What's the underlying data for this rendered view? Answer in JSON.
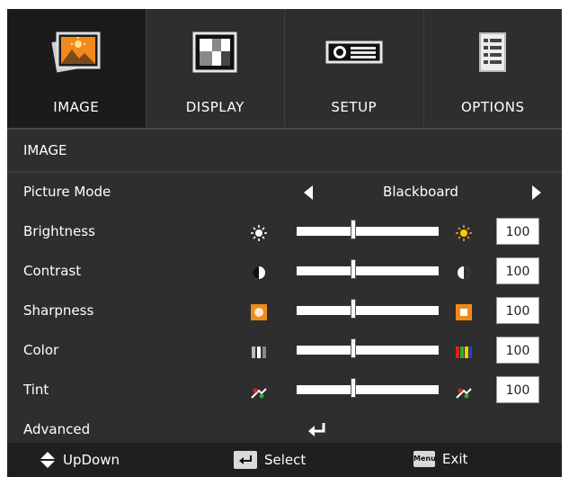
{
  "tabs": [
    {
      "label": "IMAGE",
      "icon": "image-icon",
      "active": true
    },
    {
      "label": "DISPLAY",
      "icon": "display-icon",
      "active": false
    },
    {
      "label": "SETUP",
      "icon": "setup-projector-icon",
      "active": false
    },
    {
      "label": "OPTIONS",
      "icon": "options-list-icon",
      "active": false
    }
  ],
  "section_title": "IMAGE",
  "picture_mode": {
    "label": "Picture Mode",
    "value": "Blackboard"
  },
  "settings": [
    {
      "label": "Brightness",
      "value": "100",
      "level": 0.4,
      "min_icon": "sun-dim-icon",
      "max_icon": "sun-bright-icon"
    },
    {
      "label": "Contrast",
      "value": "100",
      "level": 0.4,
      "min_icon": "contrast-low-icon",
      "max_icon": "contrast-high-icon"
    },
    {
      "label": "Sharpness",
      "value": "100",
      "level": 0.4,
      "min_icon": "sharpness-low-icon",
      "max_icon": "sharpness-high-icon"
    },
    {
      "label": "Color",
      "value": "100",
      "level": 0.4,
      "min_icon": "color-low-icon",
      "max_icon": "color-high-icon"
    },
    {
      "label": "Tint",
      "value": "100",
      "level": 0.4,
      "min_icon": "tint-low-icon",
      "max_icon": "tint-high-icon"
    }
  ],
  "advanced": {
    "label": "Advanced",
    "icon": "enter-icon"
  },
  "footer": {
    "updown": "UpDown",
    "select": "Select",
    "exit": "Exit",
    "menu_key": "Menu"
  },
  "colors": {
    "accent_orange": "#f08a1c",
    "panel": "#2e2e2e"
  }
}
